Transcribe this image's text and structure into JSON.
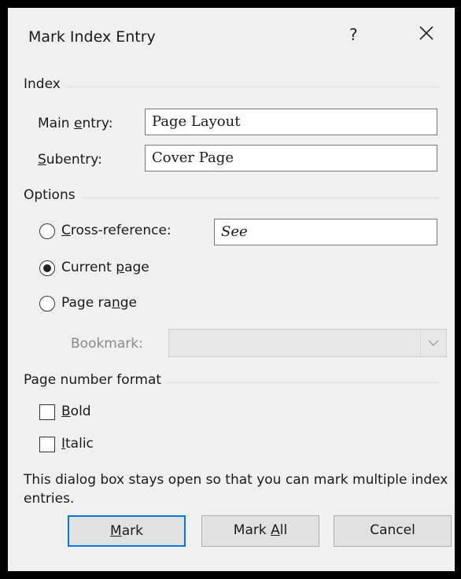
{
  "dialog": {
    "title": "Mark Index Entry",
    "help": "?",
    "close_icon": "close-icon"
  },
  "index_group": {
    "label": "Index",
    "main_entry_label_pre": "Main ",
    "main_entry_label_ul": "e",
    "main_entry_label_post": "ntry:",
    "main_entry_value": "Page Layout",
    "subentry_label_ul": "S",
    "subentry_label_post": "ubentry:",
    "subentry_value": "Cover Page"
  },
  "options_group": {
    "label": "Options",
    "cross_ref_label_ul": "C",
    "cross_ref_label_post": "ross-reference:",
    "cross_ref_value": "See",
    "current_page_label_pre": "Current ",
    "current_page_label_ul": "p",
    "current_page_label_post": "age",
    "page_range_label_pre": "Page ra",
    "page_range_label_ul": "n",
    "page_range_label_post": "ge",
    "bookmark_label": "Bookmark:",
    "bookmark_value": "",
    "selected": "current_page"
  },
  "format_group": {
    "label": "Page number format",
    "bold_label_ul": "B",
    "bold_label_post": "old",
    "italic_label_ul": "I",
    "italic_label_post": "talic",
    "bold_checked": false,
    "italic_checked": false
  },
  "note": "This dialog box stays open so that you can mark multiple index entries.",
  "buttons": {
    "mark_ul": "M",
    "mark_post": "ark",
    "mark_all_pre": "Mark ",
    "mark_all_ul": "A",
    "mark_all_post": "ll",
    "cancel": "Cancel"
  },
  "colors": {
    "accent": "#0078d7",
    "dialog_bg": "#f0f0f0",
    "frame": "#000000"
  }
}
